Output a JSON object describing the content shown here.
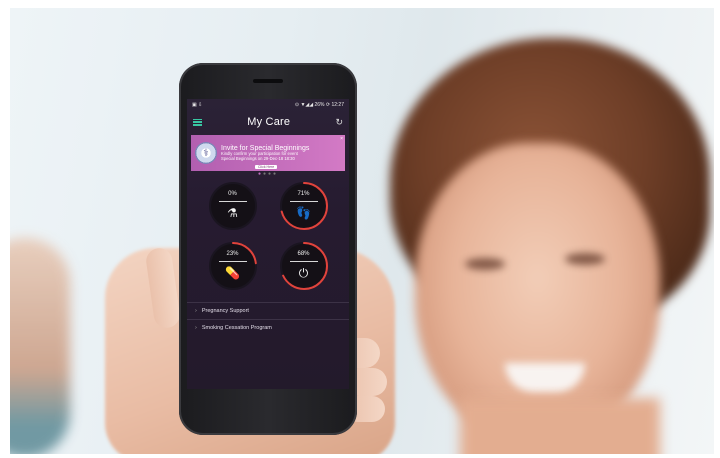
{
  "statusbar": {
    "left_icons": "▣ ⇩",
    "right_text": "⊙ ▼◢◢ 26% ⟳ 12:27"
  },
  "app": {
    "title": "My Care",
    "menu_icon": "hamburger-menu-icon",
    "refresh_icon": "refresh-icon"
  },
  "banner": {
    "title": "Invite for Special Beginnings",
    "body_line1": "Kindly confirm your participation for event",
    "body_line2": "Special Beginnings on 29-Dec-18 18:30",
    "button_label": "Click Here",
    "close_label": "×",
    "color_start": "#b25fb0",
    "color_end": "#d37ac5"
  },
  "pager": {
    "dots": 4,
    "active": 1
  },
  "gauges": [
    {
      "value_label": "0%",
      "percent": 0,
      "icon": "test-tubes-icon",
      "glyph": "🧪"
    },
    {
      "value_label": "71%",
      "percent": 71,
      "icon": "footprints-icon",
      "glyph": "👣"
    },
    {
      "value_label": "23%",
      "percent": 23,
      "icon": "pills-icon",
      "glyph": "💊"
    },
    {
      "value_label": "68%",
      "percent": 68,
      "icon": "power-timer-icon",
      "glyph": "⏻"
    }
  ],
  "gauge_colors": {
    "progress": "#e0433c",
    "track": "#1a1520",
    "fill": "#141016"
  },
  "menu": {
    "items": [
      {
        "label": "Pregnancy Support"
      },
      {
        "label": "Smoking Cessation Program"
      }
    ]
  }
}
